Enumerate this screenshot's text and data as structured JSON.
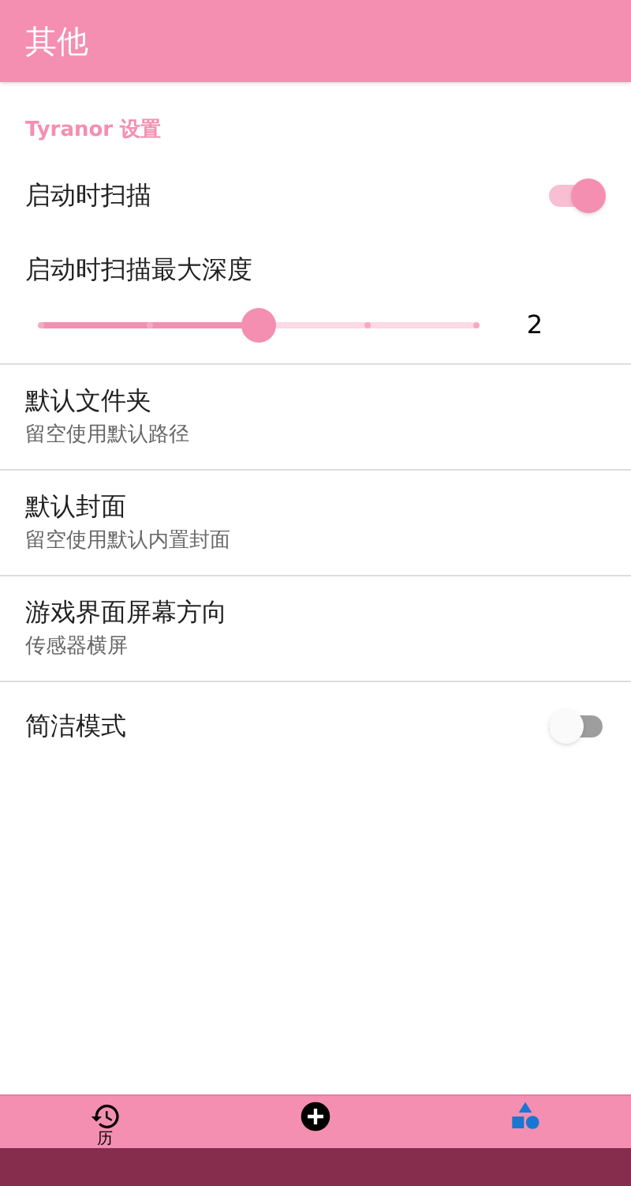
{
  "app_bar": {
    "title": "其他"
  },
  "section": {
    "title": "Tyranor 设置"
  },
  "settings": [
    {
      "kind": "switch",
      "title": "启动时扫描",
      "on": true
    },
    {
      "kind": "slider",
      "title": "启动时扫描最大深度",
      "level": 0.5,
      "reading": "2"
    },
    {
      "kind": "text",
      "title": "默认文件夹",
      "summary": "留空使用默认路径"
    },
    {
      "kind": "text",
      "title": "默认封面",
      "summary": "留空使用默认内置封面"
    },
    {
      "kind": "text",
      "title": "游戏界面屏幕方向",
      "summary": "传感器横屏"
    },
    {
      "kind": "switch",
      "title": "简洁模式",
      "on": false
    }
  ],
  "bottom_nav": [
    {
      "label": "历",
      "selected": false
    },
    {
      "selected": false
    },
    {
      "selected": true
    }
  ]
}
